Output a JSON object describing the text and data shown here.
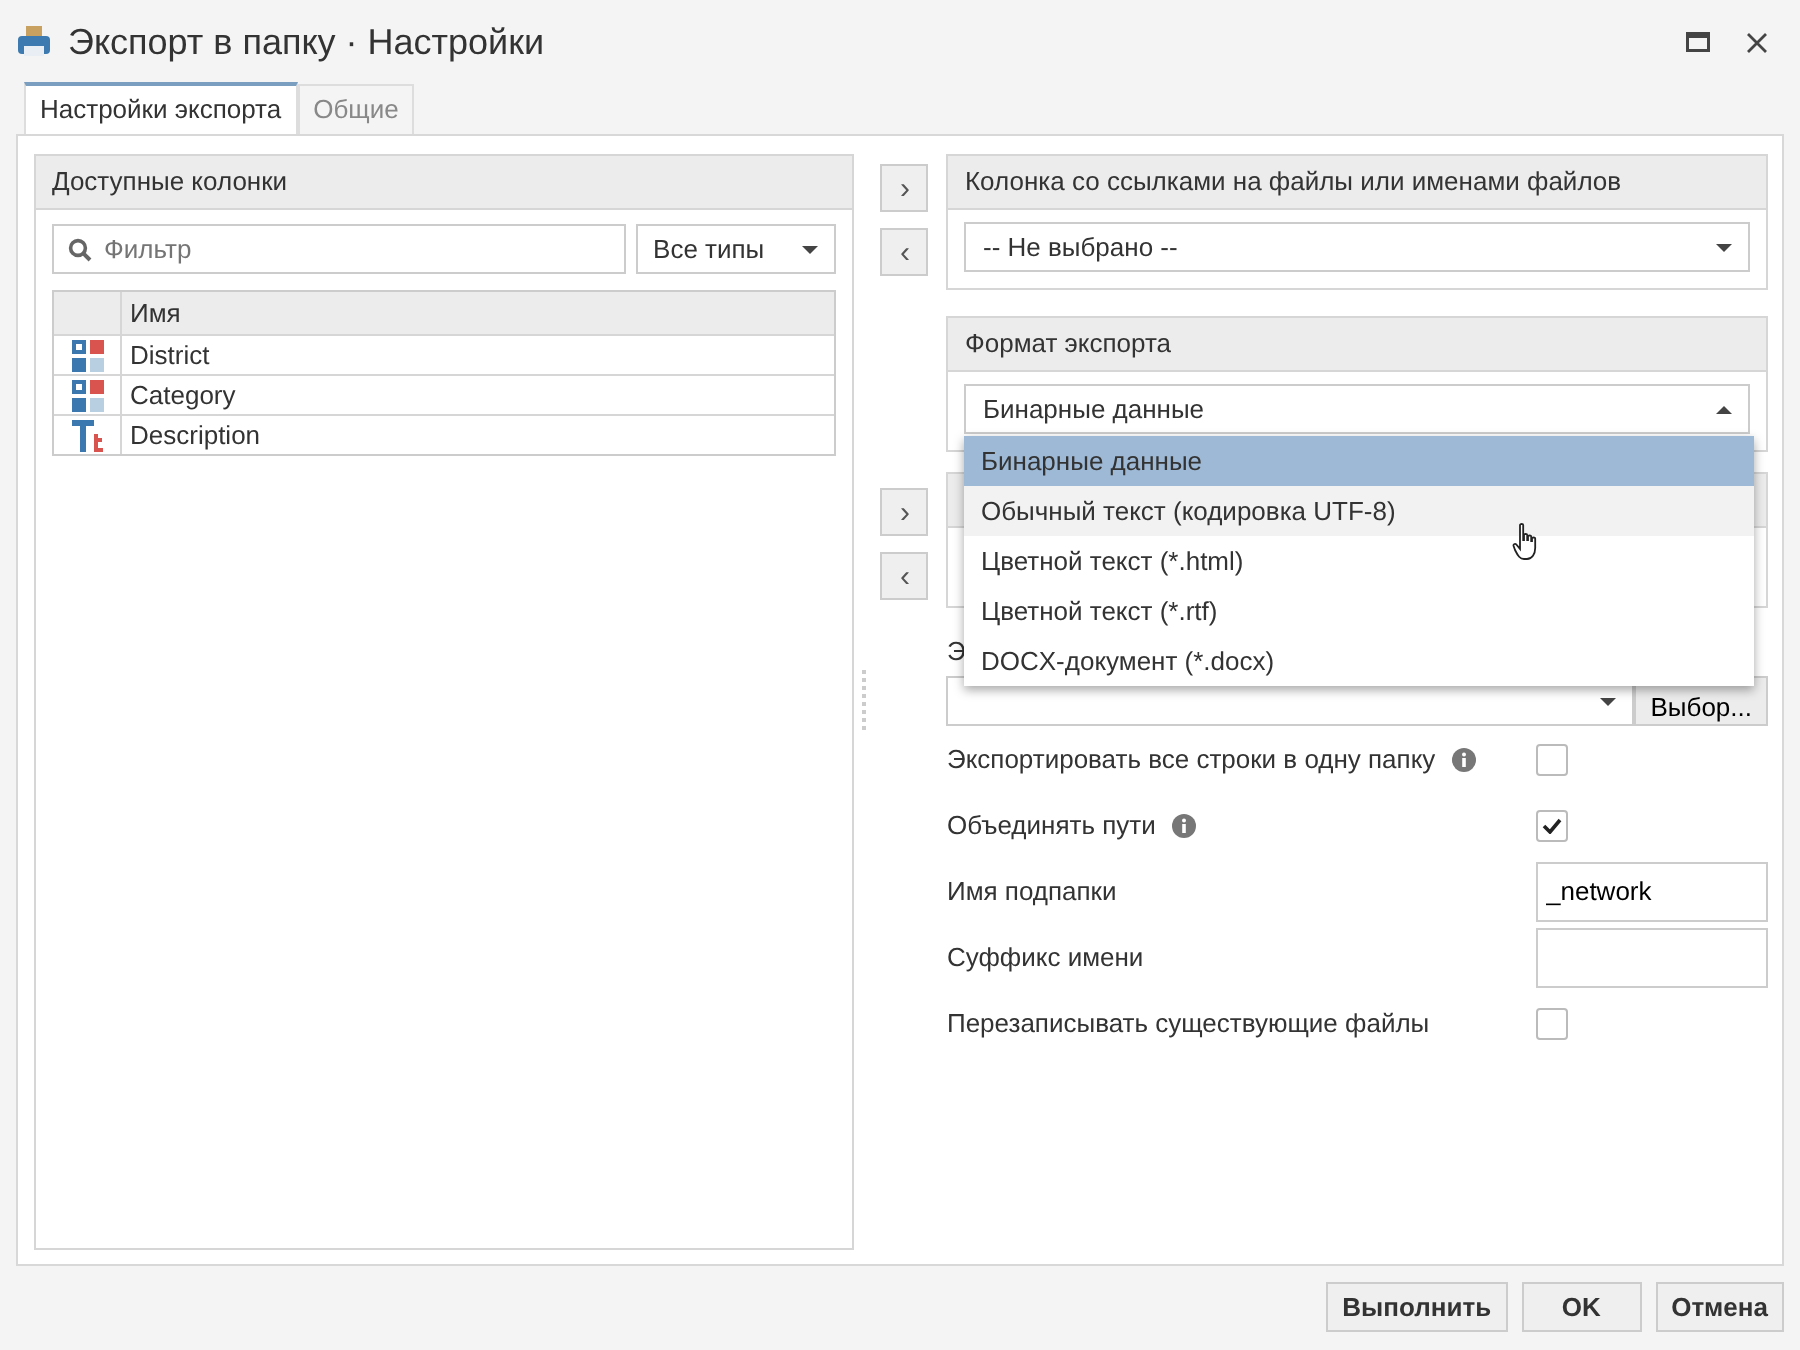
{
  "window": {
    "title": "Экспорт в папку · Настройки"
  },
  "tabs": [
    {
      "label": "Настройки экспорта",
      "selected": true
    },
    {
      "label": "Общие",
      "selected": false
    }
  ],
  "available_columns": {
    "title": "Доступные колонки",
    "filter": {
      "placeholder": "Фильтр"
    },
    "type_select": "Все типы",
    "header": "Имя",
    "rows": [
      {
        "kind": "category",
        "name": "District"
      },
      {
        "kind": "category",
        "name": "Category"
      },
      {
        "kind": "text",
        "name": "Description"
      }
    ]
  },
  "move_buttons": [
    {
      "label": "›"
    },
    {
      "label": "‹"
    },
    {
      "label": "›"
    },
    {
      "label": "‹"
    }
  ],
  "link_column": {
    "title": "Колонка со ссылками на файлы или именами файлов",
    "value": "-- Не выбрано --"
  },
  "export_format": {
    "title": "Формат экспорта",
    "value": "Бинарные данные",
    "expanded": true,
    "options": [
      {
        "label": "Бинарные данные",
        "selected": true,
        "hovered": false
      },
      {
        "label": "Обычный текст (кодировка UTF-8)",
        "selected": false,
        "hovered": true
      },
      {
        "label": "Цветной текст (*.html)",
        "selected": false,
        "hovered": false
      },
      {
        "label": "Цветной текст (*.rtf)",
        "selected": false,
        "hovered": false
      },
      {
        "label": "DOCX-документ (*.docx)",
        "selected": false,
        "hovered": false
      }
    ]
  },
  "folder": {
    "label": "Э",
    "button": "Выбор..."
  },
  "options": [
    {
      "kind": "checkbox",
      "label": "Экспортировать все строки в одну папку",
      "info": true,
      "checked": false
    },
    {
      "kind": "checkbox",
      "label": "Объединять пути",
      "info": true,
      "checked": true
    },
    {
      "kind": "text",
      "label": "Имя подпапки",
      "value": "_network"
    },
    {
      "kind": "text",
      "label": "Суффикс имени"
    },
    {
      "kind": "checkbox",
      "label": "Перезаписывать существующие файлы",
      "info": false,
      "checked": false
    }
  ],
  "buttons": [
    "Выполнить",
    "OK",
    "Отмена"
  ]
}
